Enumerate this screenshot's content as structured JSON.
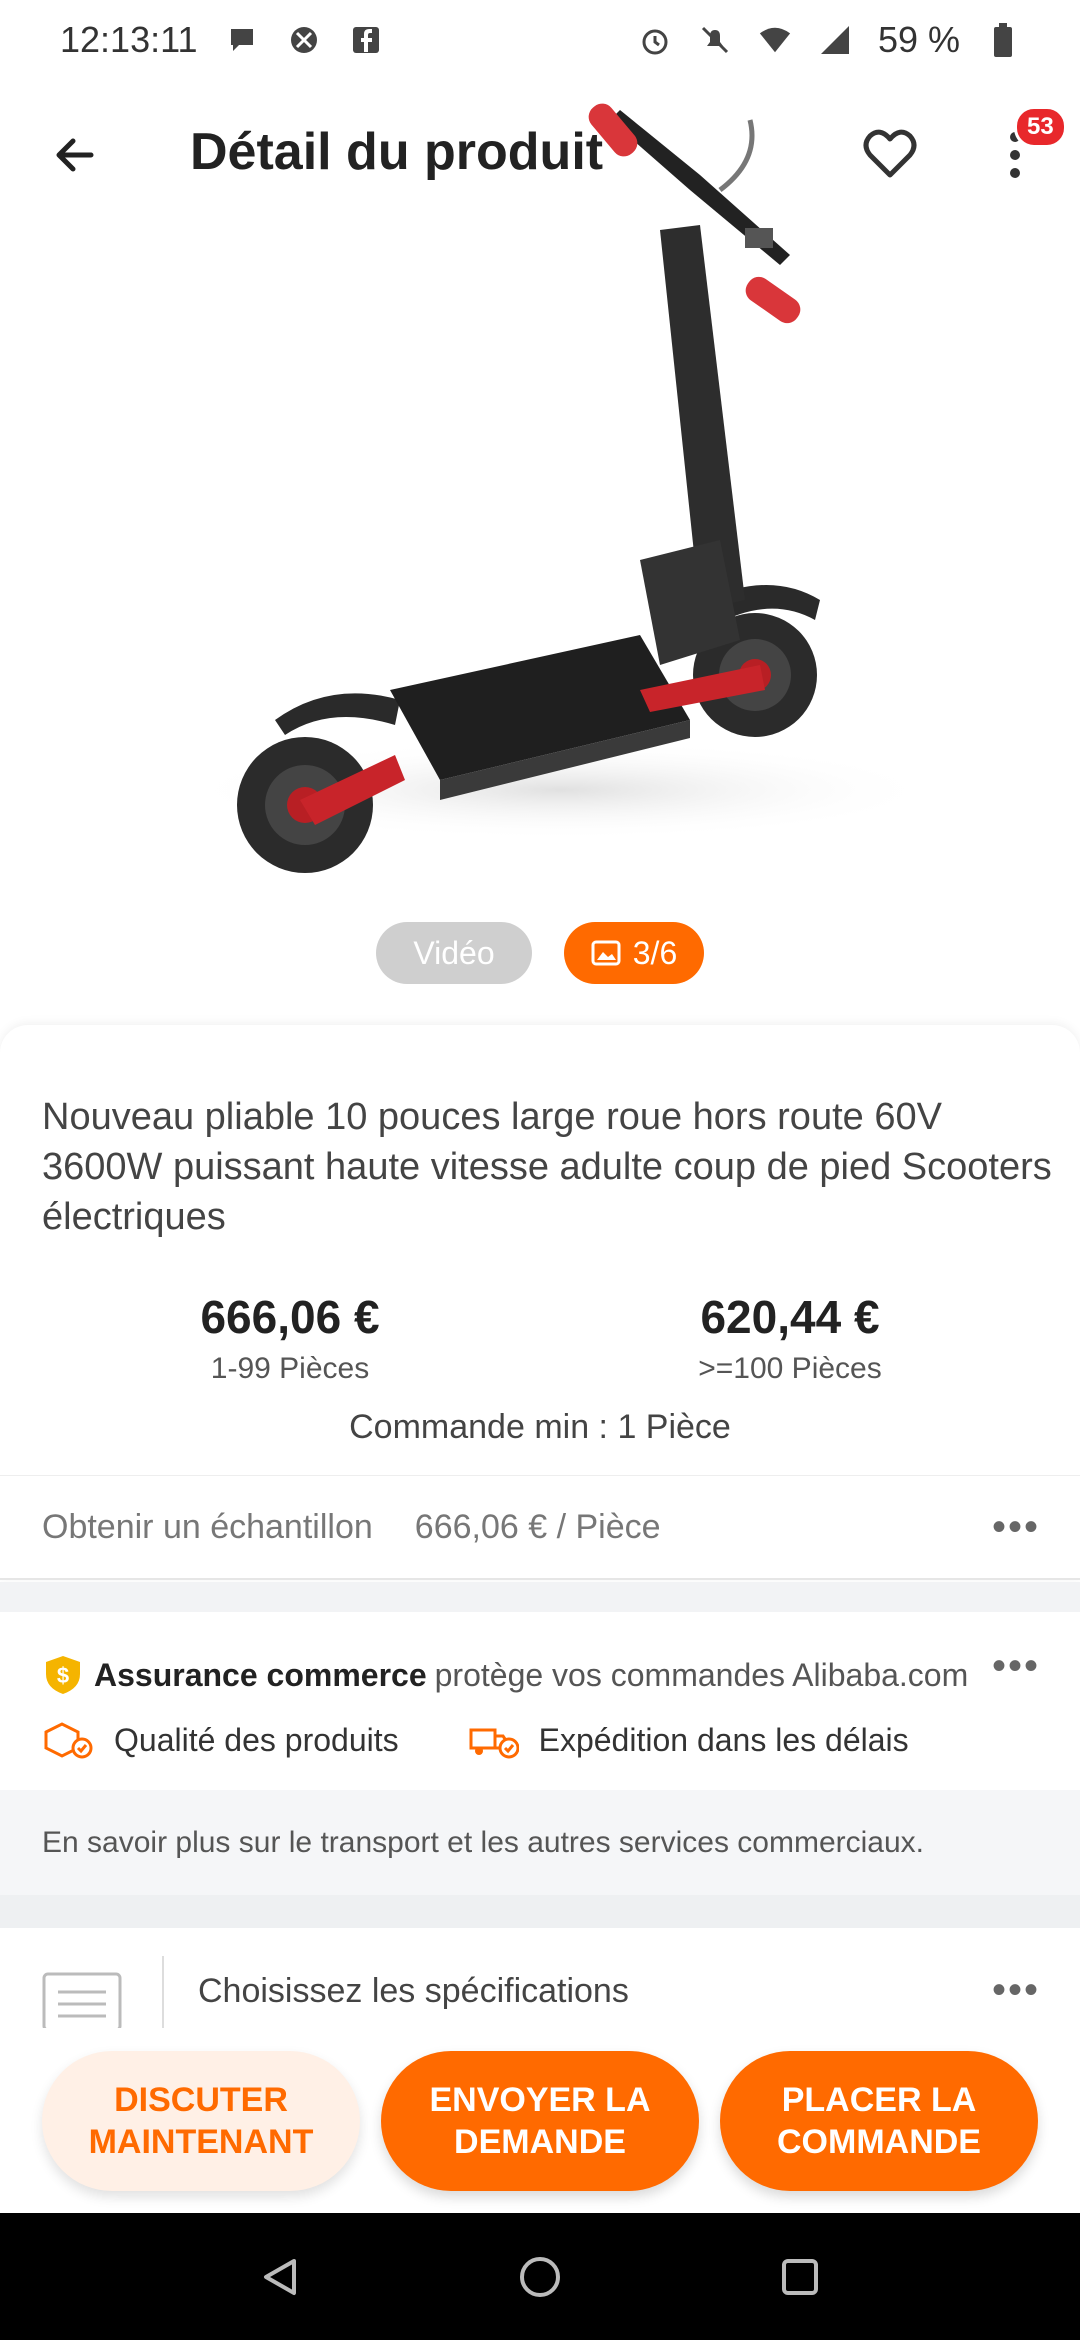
{
  "status_bar": {
    "time": "12:13:11",
    "battery": "59 %"
  },
  "app_bar": {
    "title": "Détail du produit",
    "badge_count": "53"
  },
  "media": {
    "video_label": "Vidéo",
    "photo_counter": "3/6"
  },
  "product": {
    "title": "Nouveau pliable 10 pouces large roue hors route 60V 3600W puissant haute vitesse adulte coup de pied Scooters électriques",
    "prices": [
      {
        "price": "666,06 €",
        "qty": "1-99 Pièces"
      },
      {
        "price": "620,44 €",
        "qty": ">=100 Pièces"
      }
    ],
    "min_order": "Commande min : 1 Pièce"
  },
  "sample": {
    "label": "Obtenir un échantillon",
    "price": "666,06 € / Pièce"
  },
  "assurance": {
    "brand": "Assurance commerce",
    "desc": "protège vos commandes Alibaba.com",
    "features": [
      "Qualité des produits",
      "Expédition dans les délais"
    ],
    "info": "En savoir plus sur le transport et les autres services commerciaux."
  },
  "specs": {
    "label": "Choisissez les spécifications"
  },
  "actions": {
    "chat": "DISCUTER MAINTENANT",
    "inquiry": "ENVOYER LA DEMANDE",
    "order": "PLACER LA COMMANDE"
  },
  "colors": {
    "accent": "#ff6a00",
    "badge": "#e8282b"
  }
}
